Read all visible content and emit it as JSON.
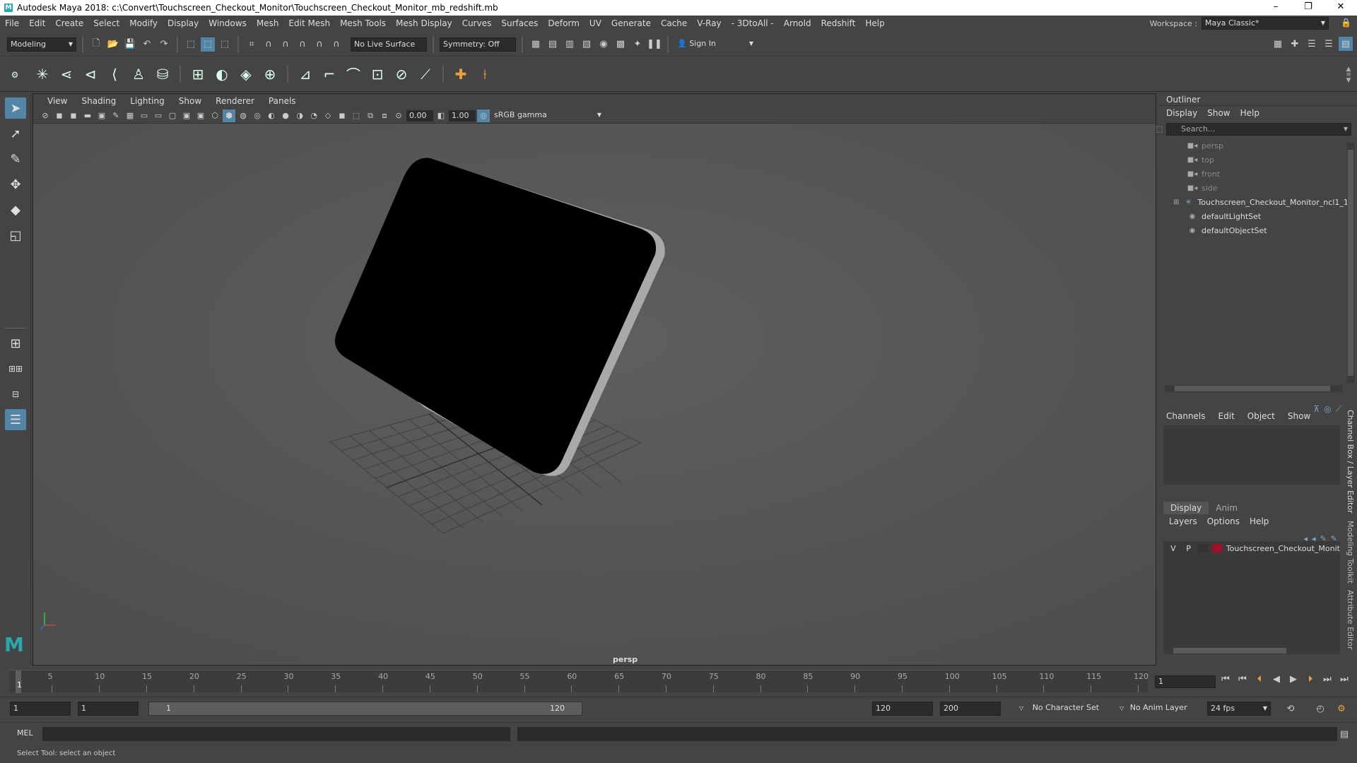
{
  "window": {
    "title": "Autodesk Maya 2018: c:\\Convert\\Touchscreen_Checkout_Monitor\\Touchscreen_Checkout_Monitor_mb_redshift.mb",
    "controls": [
      "–",
      "❐",
      "✕"
    ]
  },
  "menubar": {
    "items": [
      "File",
      "Edit",
      "Create",
      "Select",
      "Modify",
      "Display",
      "Windows",
      "Mesh",
      "Edit Mesh",
      "Mesh Tools",
      "Mesh Display",
      "Curves",
      "Surfaces",
      "Deform",
      "UV",
      "Generate",
      "Cache",
      "V-Ray",
      "- 3DtoAll -",
      "Arnold",
      "Redshift",
      "Help"
    ],
    "workspace_label": "Workspace :",
    "workspace_value": "Maya Classic*"
  },
  "statusline": {
    "menuset": "Modeling",
    "live_surface": "No Live Surface",
    "symmetry": "Symmetry: Off",
    "sign_in": "Sign In"
  },
  "viewport": {
    "menu": [
      "View",
      "Shading",
      "Lighting",
      "Show",
      "Renderer",
      "Panels"
    ],
    "exposure": "0.00",
    "gamma": "1.00",
    "color_space": "sRGB gamma",
    "camera_label": "persp"
  },
  "outliner": {
    "title": "Outliner",
    "menu": [
      "Display",
      "Show",
      "Help"
    ],
    "search_placeholder": "Search...",
    "items": [
      {
        "label": "persp",
        "icon": "camera-icon",
        "dim": true
      },
      {
        "label": "top",
        "icon": "camera-icon",
        "dim": true
      },
      {
        "label": "front",
        "icon": "camera-icon",
        "dim": true
      },
      {
        "label": "side",
        "icon": "camera-icon",
        "dim": true
      },
      {
        "label": "Touchscreen_Checkout_Monitor_ncl1_1",
        "icon": "group-icon",
        "dim": false
      },
      {
        "label": "defaultLightSet",
        "icon": "set-icon",
        "dim": false
      },
      {
        "label": "defaultObjectSet",
        "icon": "set-icon",
        "dim": false
      }
    ]
  },
  "channelbox": {
    "menu": [
      "Channels",
      "Edit",
      "Object",
      "Show"
    ]
  },
  "layers": {
    "tabs": [
      "Display",
      "Anim"
    ],
    "menu": [
      "Layers",
      "Options",
      "Help"
    ],
    "row": {
      "v": "V",
      "p": "P",
      "name": "Touchscreen_Checkout_Monit",
      "color": "#a0102a"
    }
  },
  "sidetabs": [
    "Channel Box / Layer Editor",
    "Modeling Toolkit",
    "Attribute Editor"
  ],
  "timeline": {
    "ticks": [
      "5",
      "10",
      "15",
      "20",
      "25",
      "30",
      "35",
      "40",
      "45",
      "50",
      "55",
      "60",
      "65",
      "70",
      "75",
      "80",
      "85",
      "90",
      "95",
      "100",
      "105",
      "110",
      "115",
      "120"
    ],
    "current_marker": "1",
    "current_frame": "1"
  },
  "range": {
    "start": "1",
    "playback_start": "1",
    "slider_start": "1",
    "slider_end": "120",
    "playback_end": "120",
    "end": "200",
    "character_set": "No Character Set",
    "anim_layer": "No Anim Layer",
    "fps": "24 fps"
  },
  "cmdline": {
    "label": "MEL"
  },
  "helpline": {
    "text": "Select Tool: select an object"
  }
}
